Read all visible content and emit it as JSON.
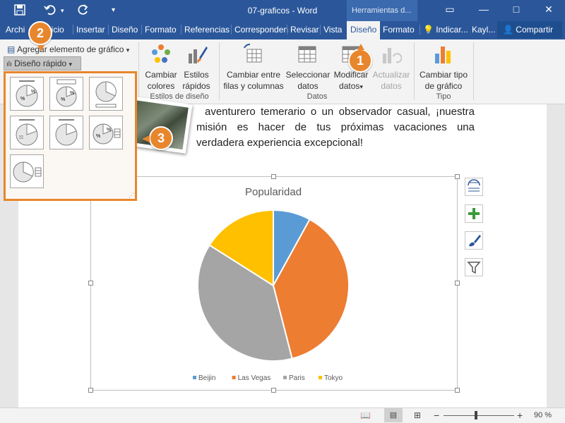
{
  "title_bar": {
    "title": "07-graficos  -  Word",
    "context_tab": "Herramientas d...",
    "save_icon": "save-icon",
    "undo_icon": "undo-icon",
    "redo_icon": "redo-icon"
  },
  "tabs": [
    "Archivo",
    "Inicio",
    "Insertar",
    "Diseño",
    "Formato",
    "Referencias",
    "Correspondencia",
    "Revisar",
    "Vista",
    "Diseño",
    "Formato"
  ],
  "tab_labels": {
    "archivo": "Archi",
    "inicio": "nicio",
    "insertar": "Insertar",
    "diseno": "Diseño",
    "formato": "Formato",
    "referencias": "Referencias",
    "correspondencia": "Corresponden",
    "revisar": "Revisar",
    "vista": "Vista",
    "diseno_chart": "Diseño",
    "formato_chart": "Formato",
    "tell_me": "Indicar...",
    "user": "Kayl...",
    "share": "Compartir"
  },
  "ribbon": {
    "add_element": "Agregar elemento de gráfico",
    "quick_layout": "Diseño rápido",
    "change_colors_1": "Cambiar",
    "change_colors_2": "colores",
    "quick_styles_1": "Estilos",
    "quick_styles_2": "rápidos",
    "styles_group": "Estilos de diseño",
    "switch_1": "Cambiar entre",
    "switch_2": "filas y columnas",
    "select_1": "Seleccionar",
    "select_2": "datos",
    "edit_1": "Modificar",
    "edit_2": "datos",
    "refresh_1": "Actualizar",
    "refresh_2": "datos",
    "data_group": "Datos",
    "change_type_1": "Cambiar tipo",
    "change_type_2": "de gráfico",
    "type_group": "Tipo"
  },
  "document": {
    "paragraph": "aventurero temerario o un observador casual, ¡nuestra misión es hacer de tus próximas vacaciones una verdadera experiencia excepcional!"
  },
  "callouts": [
    "1",
    "2",
    "3"
  ],
  "chart_data": {
    "type": "pie",
    "title": "Popularidad",
    "categories": [
      "Beijin",
      "Las Vegas",
      "Paris",
      "Tokyo"
    ],
    "values": [
      8,
      38,
      38,
      16
    ],
    "colors": [
      "#5b9bd5",
      "#ed7d31",
      "#a5a5a5",
      "#ffc000"
    ],
    "legend_position": "bottom"
  },
  "status": {
    "zoom_minus": "−",
    "zoom_plus": "+",
    "zoom": "90 %"
  }
}
